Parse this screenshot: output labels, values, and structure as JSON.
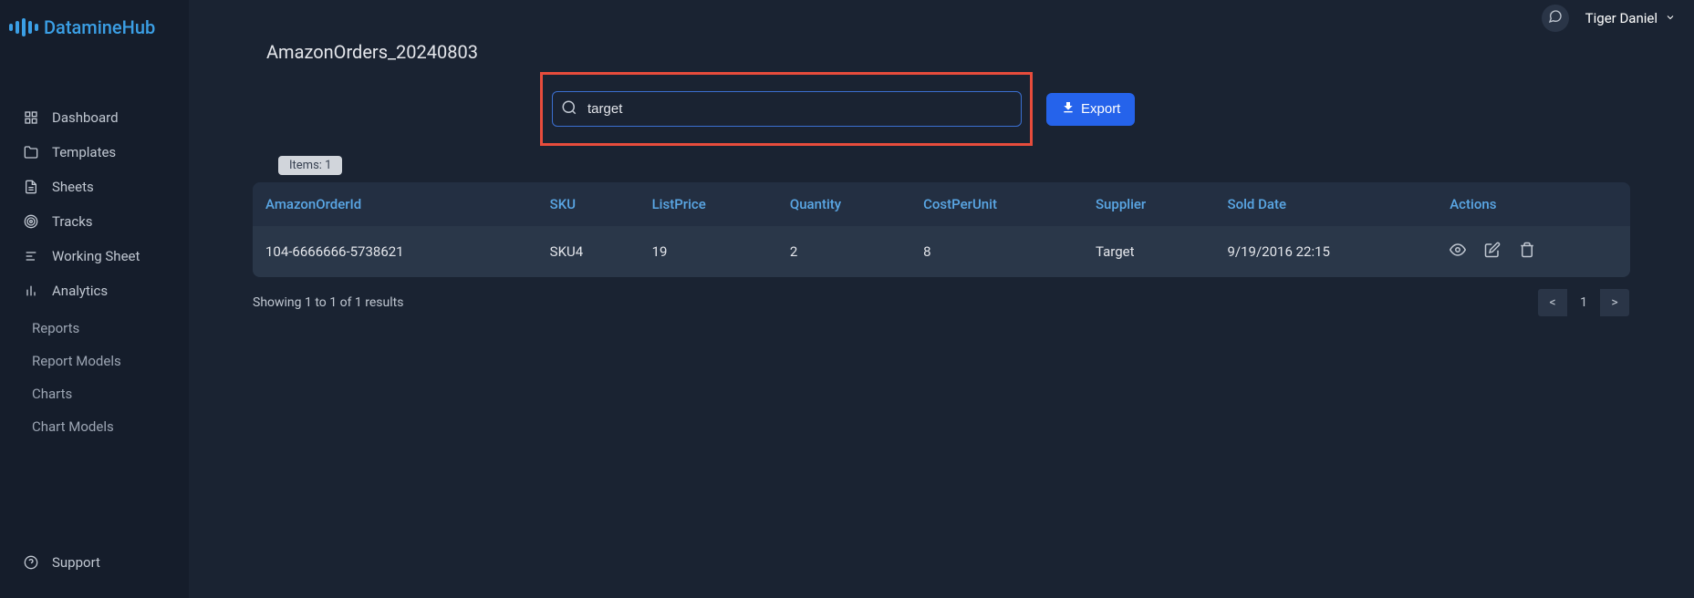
{
  "header": {
    "brand": "DatamineHub",
    "user_name": "Tiger Daniel"
  },
  "sidebar": {
    "items": [
      {
        "label": "Dashboard",
        "icon": "grid"
      },
      {
        "label": "Templates",
        "icon": "folder"
      },
      {
        "label": "Sheets",
        "icon": "file"
      },
      {
        "label": "Tracks",
        "icon": "target"
      },
      {
        "label": "Working Sheet",
        "icon": "notes"
      },
      {
        "label": "Analytics",
        "icon": "chart"
      }
    ],
    "sub_items": [
      {
        "label": "Reports"
      },
      {
        "label": "Report Models"
      },
      {
        "label": "Charts"
      },
      {
        "label": "Chart Models"
      }
    ],
    "support_label": "Support"
  },
  "page": {
    "title": "AmazonOrders_20240803",
    "search_value": "target",
    "export_label": "Export",
    "items_badge": "Items: 1",
    "results_text": "Showing 1 to 1 of 1 results"
  },
  "table": {
    "columns": [
      "AmazonOrderId",
      "SKU",
      "ListPrice",
      "Quantity",
      "CostPerUnit",
      "Supplier",
      "Sold Date",
      "Actions"
    ],
    "rows": [
      {
        "AmazonOrderId": "104-6666666-5738621",
        "SKU": "SKU4",
        "ListPrice": "19",
        "Quantity": "2",
        "CostPerUnit": "8",
        "Supplier": "Target",
        "SoldDate": "9/19/2016 22:15"
      }
    ]
  },
  "pagination": {
    "prev": "<",
    "current": "1",
    "next": ">"
  }
}
